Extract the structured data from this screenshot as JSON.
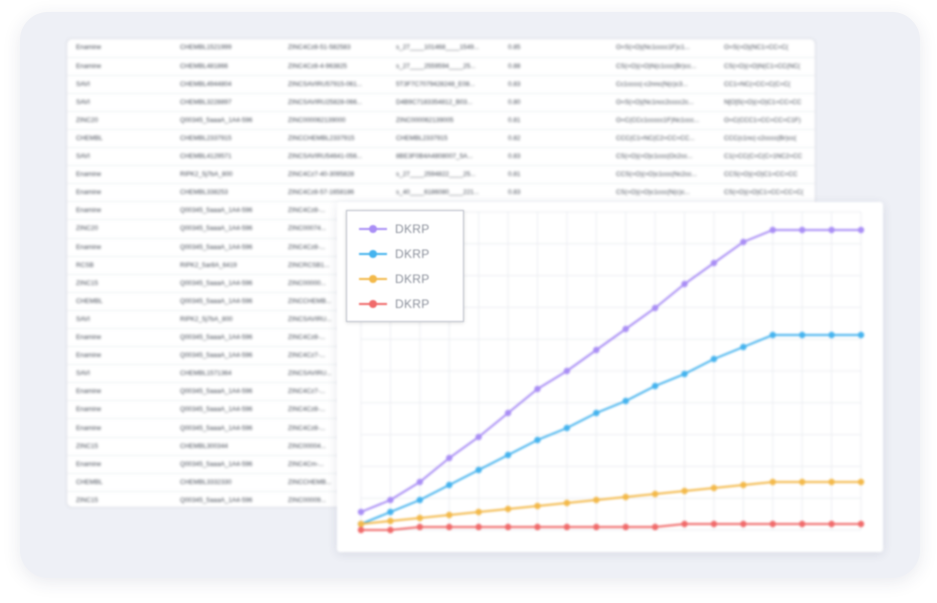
{
  "table": {
    "rows": [
      [
        "Enamine",
        "CHEMBL1521999",
        "ZINC4Cz8-51-582583",
        "s_27____101468____1549...",
        "0.85",
        "O=S(=O)(Nc1cccc1F)c1...",
        "O=S(=O)(NC1=CC=C("
      ],
      [
        "Enamine",
        "CHEMBL481866",
        "ZINC4Cz8-4-963825",
        "s_27____2559594____25...",
        "0.88",
        "CS(=O)(=O)N(c1ccc(Br)cc...",
        "CS(=O)(=O)N(C1=CC(NC("
      ],
      [
        "SAVI",
        "CHEMBL4944804",
        "ZINCSAVIRU57915-061...",
        "5T3F7C7079428248_E08...",
        "0.83",
        "Cc1cccc(-c2nnc(N(c)c3...",
        "CC1=NC(=CC=C(C=C("
      ],
      [
        "SAVI",
        "CHEMBL3228897",
        "ZINCSAVIRU25828-066...",
        "D4B9C7183354812_B03...",
        "0.80",
        "O=S(=O)(Nc1ncc2cccc2c...",
        "N[O]S(=O)(=O)C1=CC=CC"
      ],
      [
        "ZINC20",
        "Q00345_5aaaA_1A4-596",
        "ZINC000062139000",
        "ZINC000062139005",
        "0.81",
        "O=C(CCc1ccccc1F)Nc1ccc...",
        "O=C(CCC1=CC=CC=C1F)"
      ],
      [
        "CHEMBL",
        "CHEMBL2337915",
        "ZINCCHEMBL2337915",
        "CHEMBL2337915",
        "0.82",
        "CCC(C1=NC(C2=CC=CC...",
        "CCC(c1nc(-c2cccc(Br)cc("
      ],
      [
        "SAVI",
        "CHEMBL4129571",
        "ZINCSAVIRU54641-056...",
        "8BE3F0B4A4808007_5A...",
        "0.83",
        "CS(=O)(=O)c1ccc(Oc2cc...",
        "C1(=CC(C=C(C=1NC2=CC"
      ],
      [
        "Enamine",
        "RIPK2_5j7bA_800",
        "ZINC4Cz7-40-3095828",
        "s_27____2594822____25...",
        "0.81",
        "CCS(=O)(=O)c1ccc(Nc2cc...",
        "CCS(=O)(=O)C1=CC=CC"
      ],
      [
        "Enamine",
        "CHEMBL338253",
        "ZINC4Cz8-57-1658186",
        "s_40____6186080____221...",
        "0.83",
        "CS(=O)(=O)c1ccc(N(c)c...",
        "CS(=O)(=O)C1=CC=CC=C("
      ],
      [
        "Enamine",
        "Q00345_5aaaA_1A4-596",
        "ZINC4Cz8-...",
        "",
        "",
        "",
        ""
      ],
      [
        "ZINC20",
        "Q00345_5aaaA_1A4-596",
        "ZINC00074...",
        "",
        "",
        "",
        ""
      ],
      [
        "Enamine",
        "Q00345_5aaaA_1A4-596",
        "ZINC4Cz8-...",
        "",
        "",
        "",
        ""
      ],
      [
        "RCSB",
        "RIPK2_5ar8A_6419",
        "ZINCRCSB1...",
        "",
        "",
        "",
        ""
      ],
      [
        "ZINC15",
        "Q00345_5aaaA_1A4-596",
        "ZINC00000...",
        "",
        "",
        "",
        ""
      ],
      [
        "CHEMBL",
        "Q00345_5aaaA_1A4-596",
        "ZINCCHEMB...",
        "",
        "",
        "",
        ""
      ],
      [
        "SAVI",
        "RIPK2_5j7bA_800",
        "ZINCSAVIRU...",
        "",
        "",
        "",
        ""
      ],
      [
        "Enamine",
        "Q00345_5aaaA_1A4-596",
        "ZINC4Cz8-...",
        "",
        "",
        "",
        ""
      ],
      [
        "Enamine",
        "Q00345_5aaaA_1A4-596",
        "ZINC4Cz7-...",
        "",
        "",
        "",
        ""
      ],
      [
        "SAVI",
        "CHEMBL1571364",
        "ZINCSAVIRU...",
        "",
        "",
        "",
        ""
      ],
      [
        "Enamine",
        "Q00345_5aaaA_1A4-596",
        "ZINC4Cz7-...",
        "",
        "",
        "",
        ""
      ],
      [
        "Enamine",
        "Q00345_5aaaA_1A4-596",
        "ZINC4Cz8-...",
        "",
        "",
        "",
        ""
      ],
      [
        "Enamine",
        "Q00345_5aaaA_1A4-596",
        "ZINC4Cz8-...",
        "",
        "",
        "",
        ""
      ],
      [
        "ZINC15",
        "CHEMBL300344",
        "ZINC00004...",
        "",
        "",
        "",
        ""
      ],
      [
        "Enamine",
        "Q00345_5aaaA_1A4-596",
        "ZINC4Cm-...",
        "",
        "",
        "",
        ""
      ],
      [
        "CHEMBL",
        "CHEMBL3332330",
        "ZINCCHEMB...",
        "",
        "",
        "",
        ""
      ],
      [
        "ZINC15",
        "Q00345_5aaaA_1A4-596",
        "ZINC00009...",
        "",
        "",
        "",
        ""
      ]
    ]
  },
  "chart_data": {
    "type": "line",
    "x": [
      1,
      2,
      3,
      4,
      5,
      6,
      7,
      8,
      9,
      10,
      11,
      12,
      13,
      14,
      15,
      16,
      17,
      18
    ],
    "grid": true,
    "legend_placement": "top-left",
    "series": [
      {
        "name": "DKRP",
        "color": "#a98ef5",
        "values": [
          0.06,
          0.1,
          0.16,
          0.24,
          0.31,
          0.39,
          0.47,
          0.53,
          0.6,
          0.67,
          0.74,
          0.82,
          0.89,
          0.96,
          1.0,
          1.0,
          1.0,
          1.0
        ]
      },
      {
        "name": "DKRP",
        "color": "#45b3ee",
        "values": [
          0.02,
          0.06,
          0.1,
          0.15,
          0.2,
          0.25,
          0.3,
          0.34,
          0.39,
          0.43,
          0.48,
          0.52,
          0.57,
          0.61,
          0.65,
          0.65,
          0.65,
          0.65
        ]
      },
      {
        "name": "DKRP",
        "color": "#f3b94a",
        "values": [
          0.02,
          0.03,
          0.04,
          0.05,
          0.06,
          0.07,
          0.08,
          0.09,
          0.1,
          0.11,
          0.12,
          0.13,
          0.14,
          0.15,
          0.16,
          0.16,
          0.16,
          0.16
        ]
      },
      {
        "name": "DKRP",
        "color": "#f06a6a",
        "values": [
          0.0,
          0.0,
          0.01,
          0.01,
          0.01,
          0.01,
          0.01,
          0.01,
          0.01,
          0.01,
          0.01,
          0.02,
          0.02,
          0.02,
          0.02,
          0.02,
          0.02,
          0.02
        ]
      }
    ],
    "ylim": [
      0,
      1.06
    ]
  }
}
